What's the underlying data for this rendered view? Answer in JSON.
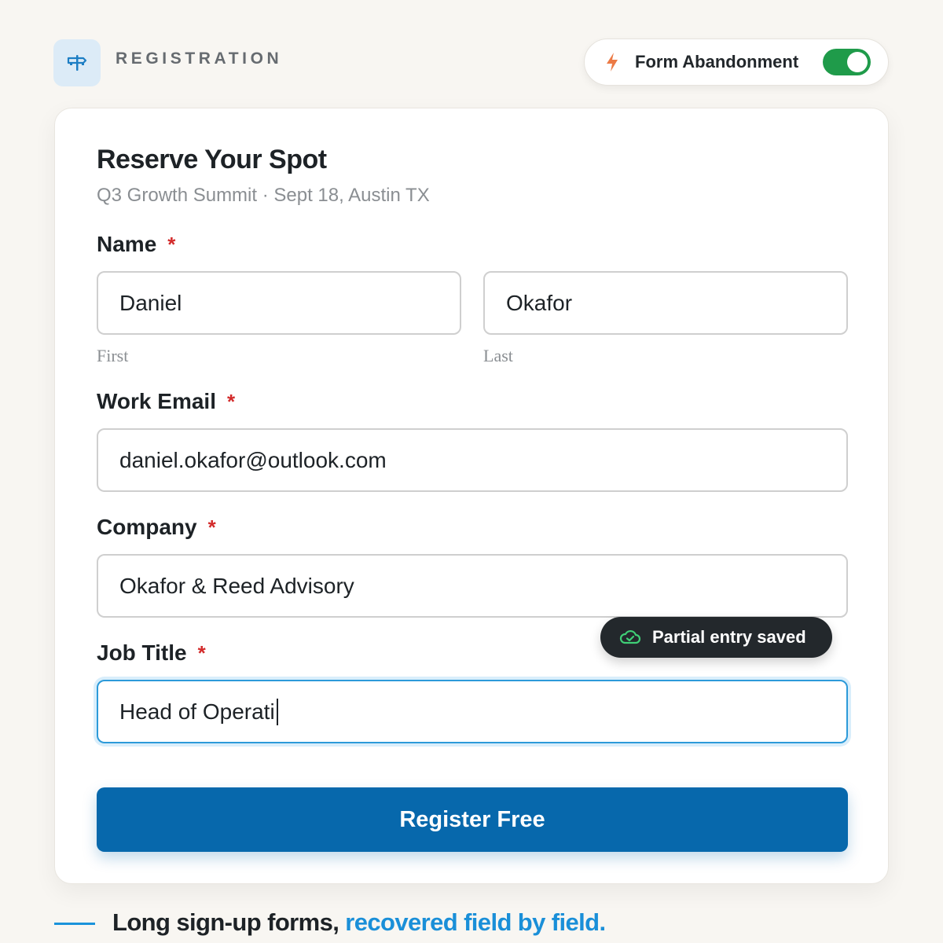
{
  "header": {
    "section_label": "REGISTRATION",
    "toggle": {
      "label": "Form Abandonment",
      "on": true
    }
  },
  "form": {
    "title": "Reserve Your Spot",
    "subtitle": "Q3 Growth Summit · Sept 18, Austin TX",
    "required_mark": "*",
    "name": {
      "label": "Name",
      "first_value": "Daniel",
      "first_sub": "First",
      "last_value": "Okafor",
      "last_sub": "Last"
    },
    "email": {
      "label": "Work Email",
      "value": "daniel.okafor@outlook.com"
    },
    "company": {
      "label": "Company",
      "value": "Okafor & Reed Advisory"
    },
    "job_title": {
      "label": "Job Title",
      "value": "Head of Operati"
    },
    "toast": "Partial entry saved",
    "submit_label": "Register Free"
  },
  "footer": {
    "tagline_main": "Long sign-up forms,",
    "tagline_highlight": "recovered field by field."
  },
  "colors": {
    "accent": "#0768ac",
    "toggle_on": "#1f9b4a",
    "required": "#d32b2b",
    "highlight": "#1a8fd8"
  },
  "icons": {
    "brand": "signpost-icon",
    "toggle": "bolt-icon",
    "toast": "cloud-check-icon"
  }
}
